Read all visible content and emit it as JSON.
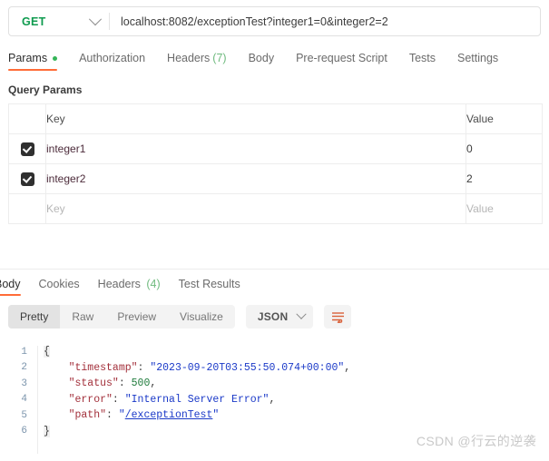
{
  "request": {
    "method": "GET",
    "method_icon": "chevron-down-icon",
    "url": "localhost:8082/exceptionTest?integer1=0&integer2=2",
    "tabs": [
      {
        "label": "Params",
        "active": true,
        "dot": true
      },
      {
        "label": "Authorization",
        "active": false,
        "dot": false
      },
      {
        "label": "Headers",
        "count": "(7)",
        "active": false,
        "dot": false
      },
      {
        "label": "Body",
        "active": false,
        "dot": false
      },
      {
        "label": "Pre-request Script",
        "active": false,
        "dot": false
      },
      {
        "label": "Tests",
        "active": false,
        "dot": false
      },
      {
        "label": "Settings",
        "active": false,
        "dot": false
      }
    ]
  },
  "query_params": {
    "section_title": "Query Params",
    "headers": {
      "key": "Key",
      "value": "Value"
    },
    "rows": [
      {
        "checked": true,
        "key": "integer1",
        "value": "0",
        "is_placeholder": false
      },
      {
        "checked": true,
        "key": "integer2",
        "value": "2",
        "is_placeholder": false
      },
      {
        "checked": false,
        "key": "Key",
        "value": "Value",
        "is_placeholder": true
      }
    ]
  },
  "response": {
    "tabs": [
      {
        "label": "Body",
        "active": true
      },
      {
        "label": "Cookies",
        "active": false
      },
      {
        "label": "Headers",
        "count": "(4)",
        "active": false
      },
      {
        "label": "Test Results",
        "active": false
      }
    ],
    "view_modes": [
      {
        "label": "Pretty",
        "active": true
      },
      {
        "label": "Raw",
        "active": false
      },
      {
        "label": "Preview",
        "active": false
      },
      {
        "label": "Visualize",
        "active": false
      }
    ],
    "format": "JSON",
    "format_icon": "chevron-down-icon",
    "wrap_icon": "word-wrap-icon",
    "body_lines": [
      {
        "n": "1",
        "tokens": [
          {
            "t": "{",
            "c": "brace"
          }
        ]
      },
      {
        "n": "2",
        "tokens": [
          {
            "t": "    \"timestamp\"",
            "c": "key"
          },
          {
            "t": ": ",
            "c": "punct"
          },
          {
            "t": "\"2023-09-20T03:55:50.074+00:00\"",
            "c": "str"
          },
          {
            "t": ",",
            "c": "punct"
          }
        ]
      },
      {
        "n": "3",
        "tokens": [
          {
            "t": "    \"status\"",
            "c": "key"
          },
          {
            "t": ": ",
            "c": "punct"
          },
          {
            "t": "500",
            "c": "num"
          },
          {
            "t": ",",
            "c": "punct"
          }
        ]
      },
      {
        "n": "4",
        "tokens": [
          {
            "t": "    \"error\"",
            "c": "key"
          },
          {
            "t": ": ",
            "c": "punct"
          },
          {
            "t": "\"Internal Server Error\"",
            "c": "str"
          },
          {
            "t": ",",
            "c": "punct"
          }
        ]
      },
      {
        "n": "5",
        "tokens": [
          {
            "t": "    \"path\"",
            "c": "key"
          },
          {
            "t": ": ",
            "c": "punct"
          },
          {
            "t": "\"",
            "c": "str"
          },
          {
            "t": "/exceptionTest",
            "c": "link"
          },
          {
            "t": "\"",
            "c": "str"
          }
        ]
      },
      {
        "n": "6",
        "tokens": [
          {
            "t": "}",
            "c": "brace"
          }
        ]
      }
    ]
  },
  "watermark": "CSDN @行云的逆袭",
  "colors": {
    "accent": "#ff6c37",
    "method_get": "#0f9b4f",
    "dot_green": "#35b558"
  }
}
